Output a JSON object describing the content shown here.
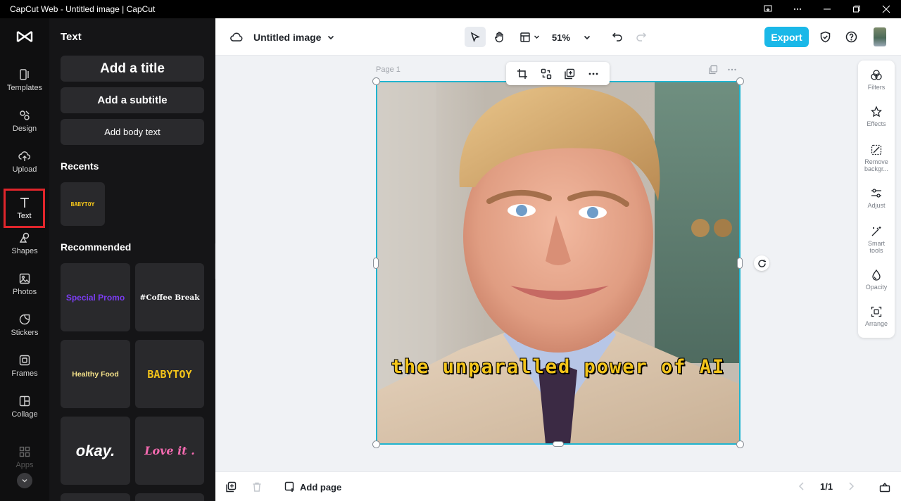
{
  "window": {
    "title": "CapCut Web - Untitled image | CapCut"
  },
  "leftnav": {
    "items": [
      {
        "label": "Templates",
        "icon": "templates-icon"
      },
      {
        "label": "Design",
        "icon": "design-icon"
      },
      {
        "label": "Upload",
        "icon": "upload-icon"
      },
      {
        "label": "Text",
        "icon": "text-icon",
        "active": true
      },
      {
        "label": "Shapes",
        "icon": "shapes-icon"
      },
      {
        "label": "Photos",
        "icon": "photos-icon"
      },
      {
        "label": "Stickers",
        "icon": "stickers-icon"
      },
      {
        "label": "Frames",
        "icon": "frames-icon"
      },
      {
        "label": "Collage",
        "icon": "collage-icon"
      },
      {
        "label": "Apps",
        "icon": "apps-icon"
      }
    ]
  },
  "panel": {
    "title": "Text",
    "add_title": "Add a title",
    "add_subtitle": "Add a subtitle",
    "add_body": "Add body text",
    "recents_label": "Recents",
    "recents": [
      "BABYTOY"
    ],
    "recommended_label": "Recommended",
    "recommended": [
      "Special Promo",
      "#Coffee Break",
      "Healthy Food",
      "BABYTOY",
      "okay.",
      "Love it ."
    ]
  },
  "topbar": {
    "doc_name": "Untitled image",
    "zoom": "51%",
    "export_label": "Export"
  },
  "canvas": {
    "page_label": "Page 1",
    "caption": "the unparalled power of AI"
  },
  "rail": {
    "items": [
      {
        "label": "Filters",
        "icon": "filters-icon"
      },
      {
        "label": "Effects",
        "icon": "effects-icon"
      },
      {
        "label": "Remove backgr...",
        "icon": "remove-background-icon"
      },
      {
        "label": "Adjust",
        "icon": "adjust-icon"
      },
      {
        "label": "Smart tools",
        "icon": "smart-tools-icon"
      },
      {
        "label": "Opacity",
        "icon": "opacity-icon"
      },
      {
        "label": "Arrange",
        "icon": "arrange-icon"
      }
    ]
  },
  "bottombar": {
    "add_page": "Add page",
    "page_count": "1/1"
  },
  "colors": {
    "accent": "#1ab8e8",
    "selection": "#1fb4cf",
    "active_outline": "#e0252b",
    "caption": "#f4c51a"
  }
}
